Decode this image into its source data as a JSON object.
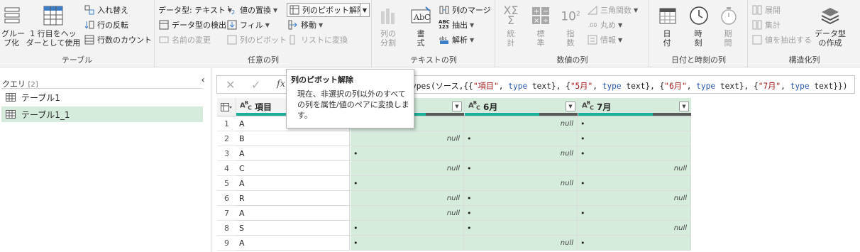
{
  "ribbon": {
    "groups": {
      "table": "テーブル",
      "any_column": "任意の列",
      "text_column": "テキストの列",
      "number_column": "数値の列",
      "datetime_column": "日付と時刻の列",
      "structured_column": "構造化列"
    },
    "table": {
      "group_by": "グルー\nプ化",
      "first_row_header": "1 行目をヘッ\nダーとして使用",
      "transpose": "入れ替え",
      "reverse_rows": "行の反転",
      "count_rows": "行数のカウント"
    },
    "any": {
      "data_type": "データ型: テキスト",
      "detect_type": "データ型の検出",
      "rename": "名前の変更",
      "replace_values": "値の置換",
      "fill": "フィル",
      "pivot": "列のピボット",
      "unpivot": "列のピボット解除",
      "move": "移動",
      "to_list": "リストに変換"
    },
    "text": {
      "split_column": "列の\n分割",
      "format": "書\n式",
      "merge_columns": "列のマージ",
      "extract": "抽出",
      "parse": "解析"
    },
    "number": {
      "statistics": "統\n計",
      "standard": "標\n準",
      "scientific": "指\n数",
      "trigonometry": "三角関数",
      "rounding": "丸め",
      "information": "情報"
    },
    "datetime": {
      "date": "日\n付",
      "time": "時\n刻",
      "duration": "期\n間"
    },
    "structured": {
      "expand": "展開",
      "aggregate": "集計",
      "extract_values": "値を抽出する",
      "create_data_type": "データ型\nの作成"
    }
  },
  "queries": {
    "header": "クエリ",
    "count": "[2]",
    "items": [
      "テーブル1",
      "テーブル1_1"
    ],
    "selected_index": 1
  },
  "formula": {
    "fx": "fx",
    "prefix": "ypes(ソース,{{",
    "parts": [
      {
        "s": "\"項目\"",
        "t": " text}, {"
      },
      {
        "s": "\"5月\"",
        "t": " text}, {"
      },
      {
        "s": "\"6月\"",
        "t": " text}, {"
      },
      {
        "s": "\"7月\"",
        "t": " text}})"
      }
    ]
  },
  "tooltip": {
    "title": "列のピボット解除",
    "description": "現在、非選択の列以外のすべての列を属性/値のペアに変換します。"
  },
  "grid": {
    "type_label": "ABC",
    "columns": [
      {
        "name": "項目",
        "selected": false
      },
      {
        "name": "5月",
        "selected": true
      },
      {
        "name": "6月",
        "selected": true
      },
      {
        "name": "7月",
        "selected": true
      }
    ],
    "null_text": "null",
    "dot_text": "•",
    "rows": [
      {
        "n": "1",
        "c": [
          "A",
          "•",
          "null",
          "•"
        ]
      },
      {
        "n": "2",
        "c": [
          "B",
          "null",
          "•",
          "•"
        ]
      },
      {
        "n": "3",
        "c": [
          "A",
          "•",
          "null",
          "•"
        ]
      },
      {
        "n": "4",
        "c": [
          "C",
          "null",
          "•",
          "null"
        ]
      },
      {
        "n": "5",
        "c": [
          "A",
          "•",
          "null",
          "•"
        ]
      },
      {
        "n": "6",
        "c": [
          "R",
          "null",
          "•",
          "null"
        ]
      },
      {
        "n": "7",
        "c": [
          "A",
          "null",
          "•",
          "•"
        ]
      },
      {
        "n": "8",
        "c": [
          "S",
          "•",
          "•",
          "null"
        ]
      },
      {
        "n": "9",
        "c": [
          "A",
          "•",
          "null",
          "•"
        ]
      }
    ]
  },
  "colors": {
    "selected_col_bg": "#d5ebdc",
    "quality_valid": "#19b09a",
    "quality_empty": "#595959"
  }
}
